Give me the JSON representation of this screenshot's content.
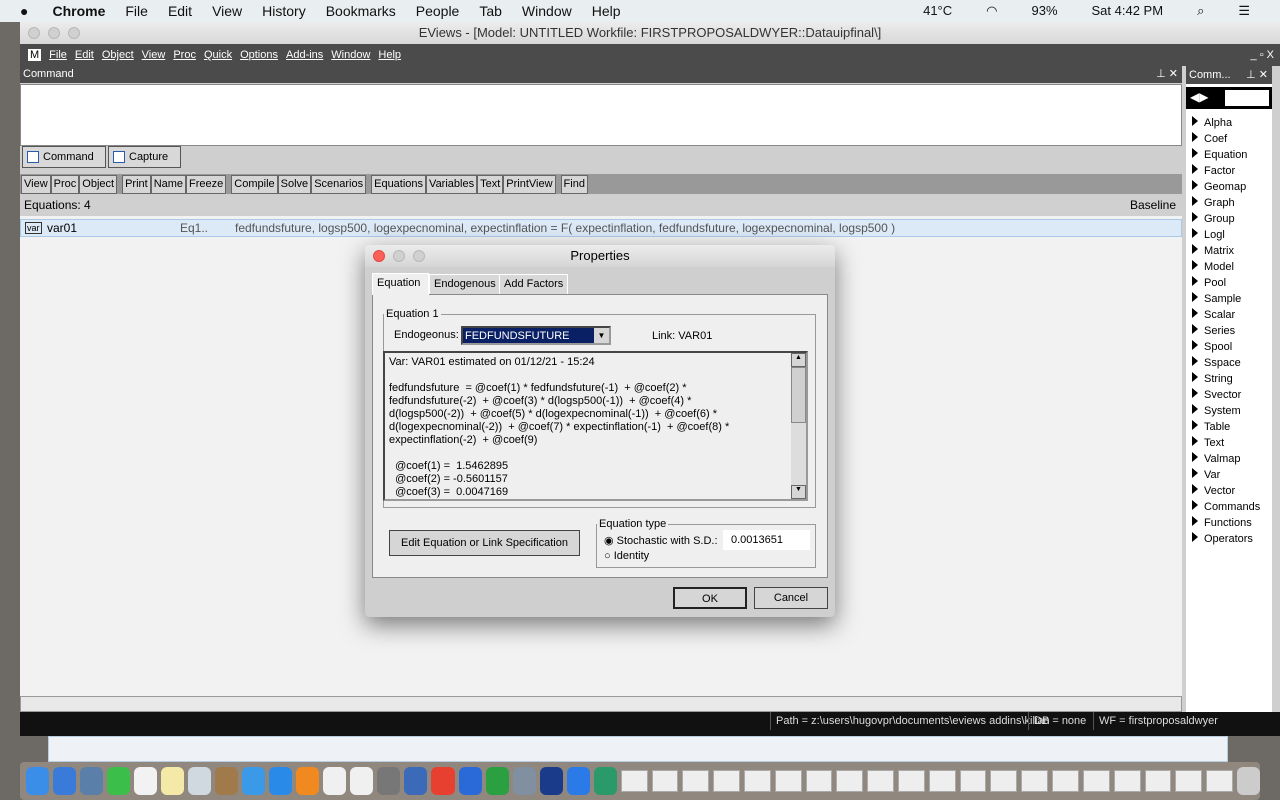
{
  "mac_menubar": {
    "app": "Chrome",
    "items": [
      "File",
      "Edit",
      "View",
      "History",
      "Bookmarks",
      "People",
      "Tab",
      "Window",
      "Help"
    ],
    "status": {
      "temperature": "41°C",
      "battery": "93%",
      "clock": "Sat 4:42 PM"
    }
  },
  "window": {
    "title": "EViews - [Model: UNTITLED   Workfile: FIRSTPROPOSALDWYER::Datauipfinal\\]",
    "menu": [
      "File",
      "Edit",
      "Object",
      "View",
      "Proc",
      "Quick",
      "Options",
      "Add-ins",
      "Window",
      "Help"
    ],
    "command_header": "Command",
    "tabs": [
      "Command",
      "Capture"
    ],
    "toolbar": [
      [
        "View",
        "Proc",
        "Object"
      ],
      [
        "Print",
        "Name",
        "Freeze"
      ],
      [
        "Compile",
        "Solve",
        "Scenarios"
      ],
      [
        "Equations",
        "Variables",
        "Text",
        "PrintView"
      ],
      [
        "Find"
      ]
    ],
    "equations_count": "Equations: 4",
    "baseline": "Baseline",
    "row": {
      "icon": "var",
      "name": "var01",
      "eq": "Eq1..",
      "spec": "fedfundsfuture, logsp500, logexpecnominal, expectinflation  =  F( expectinflation, fedfundsfuture, logexpecnominal, logsp500 )"
    },
    "status": {
      "path": "Path = z:\\users\\hugovpr\\documents\\eviews addins\\kilian",
      "db": "DB = none",
      "wf": "WF = firstproposaldwyer"
    }
  },
  "right_panel": {
    "title": "Comm...",
    "items": [
      "Alpha",
      "Coef",
      "Equation",
      "Factor",
      "Geomap",
      "Graph",
      "Group",
      "Logl",
      "Matrix",
      "Model",
      "Pool",
      "Sample",
      "Scalar",
      "Series",
      "Spool",
      "Sspace",
      "String",
      "Svector",
      "System",
      "Table",
      "Text",
      "Valmap",
      "Var",
      "Vector",
      "Commands",
      "Functions",
      "Operators"
    ]
  },
  "dialog": {
    "title": "Properties",
    "tabs": [
      "Equation",
      "Endogenous",
      "Add Factors"
    ],
    "group": "Equation 1",
    "endog_label": "Endogeonus:",
    "endog_value": "FEDFUNDSFUTURE",
    "link": "Link:  VAR01",
    "text": "Var: VAR01 estimated on 01/12/21 - 15:24\n\nfedfundsfuture  = @coef(1) * fedfundsfuture(-1)  + @coef(2) *\nfedfundsfuture(-2)  + @coef(3) * d(logsp500(-1))  + @coef(4) *\nd(logsp500(-2))  + @coef(5) * d(logexpecnominal(-1))  + @coef(6) *\nd(logexpecnominal(-2))  + @coef(7) * expectinflation(-1)  + @coef(8) *\nexpectinflation(-2)  + @coef(9)\n\n  @coef(1) =  1.5462895\n  @coef(2) = -0.5601157\n  @coef(3) =  0.0047169",
    "edit_button": "Edit Equation or Link Specification",
    "eqtype_label": "Equation type",
    "stochastic": "Stochastic with S.D.:",
    "sd_value": "0.0013651",
    "identity": "Identity",
    "ok": "OK",
    "cancel": "Cancel"
  }
}
